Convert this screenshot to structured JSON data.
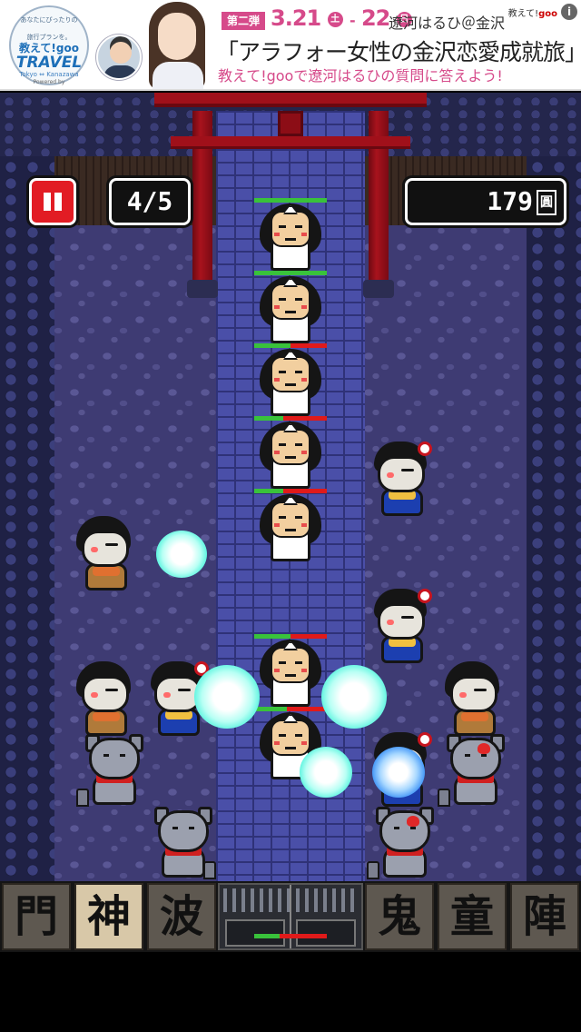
{
  "ad": {
    "stamp": {
      "line1": "あなたにぴったりの",
      "line1b": "旅行プランを。",
      "line2": "教えて!goo",
      "line3": "TRAVEL",
      "line4": "Tokyo ⇔ Kanazawa",
      "line5": "Powered by"
    },
    "round_label": "第二弾",
    "date_start": "3.21",
    "day_start": "土",
    "date_end": "22",
    "day_end": "日",
    "guest": "遼河はるひ＠金沢",
    "title": "「アラフォー女性の金沢恋愛成就旅」",
    "subtitle": "教えて!gooで遼河はるひの質問に答えよう!",
    "badge_prefix": "教えて!",
    "badge_brand": "goo",
    "info_glyph": "i"
  },
  "hud": {
    "wave": "4/5",
    "money": "179",
    "money_unit": "圓"
  },
  "enemies": [
    {
      "hp": 1.0
    },
    {
      "hp": 1.0
    },
    {
      "hp": 0.5
    },
    {
      "hp": 0.4
    },
    {
      "hp": 0.4
    },
    {
      "hp": 0.5
    },
    {
      "hp": 0.45
    }
  ],
  "toolbar": {
    "left": [
      "門",
      "神",
      "波"
    ],
    "right": [
      "鬼",
      "童",
      "陣"
    ],
    "gate_hp": 0.35
  }
}
